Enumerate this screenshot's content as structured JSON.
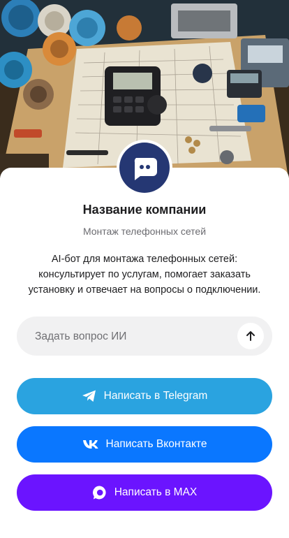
{
  "company": {
    "name": "Название компании",
    "subtitle": "Монтаж телефонных сетей",
    "description": "AI-бот для монтажа телефонных сетей: консультирует по услугам, помогает заказать установку и отвечает на вопросы о подключении."
  },
  "ask": {
    "placeholder": "Задать вопрос ИИ",
    "value": ""
  },
  "buttons": {
    "telegram": {
      "label": "Написать в Telegram",
      "color": "#2aa3e0",
      "icon": "telegram-icon"
    },
    "vk": {
      "label": "Написать Вконтакте",
      "color": "#0a77ff",
      "icon": "vk-icon"
    },
    "max": {
      "label": "Написать в MAX",
      "color": "#6b14ff",
      "icon": "max-icon"
    }
  },
  "colors": {
    "avatar_bg": "#253773",
    "input_bg": "#f1f1f2"
  }
}
